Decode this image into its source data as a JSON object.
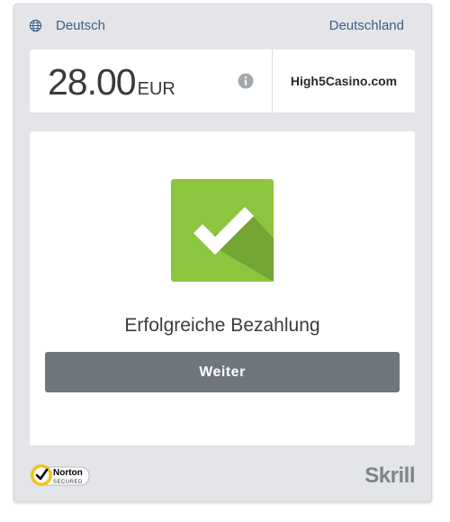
{
  "header": {
    "language": "Deutsch",
    "country": "Deutschland"
  },
  "payment": {
    "amount": "28.00",
    "currency": "EUR",
    "merchant": "High5Casino.com"
  },
  "status": {
    "message": "Erfolgreiche Bezahlung",
    "button_label": "Weiter"
  },
  "footer": {
    "norton_name": "Norton",
    "norton_sub": "SECURED",
    "brand": "Skrill"
  },
  "colors": {
    "success_green": "#8cc63f",
    "button_gray": "#6f767e",
    "link_blue": "#3d5f8b"
  }
}
